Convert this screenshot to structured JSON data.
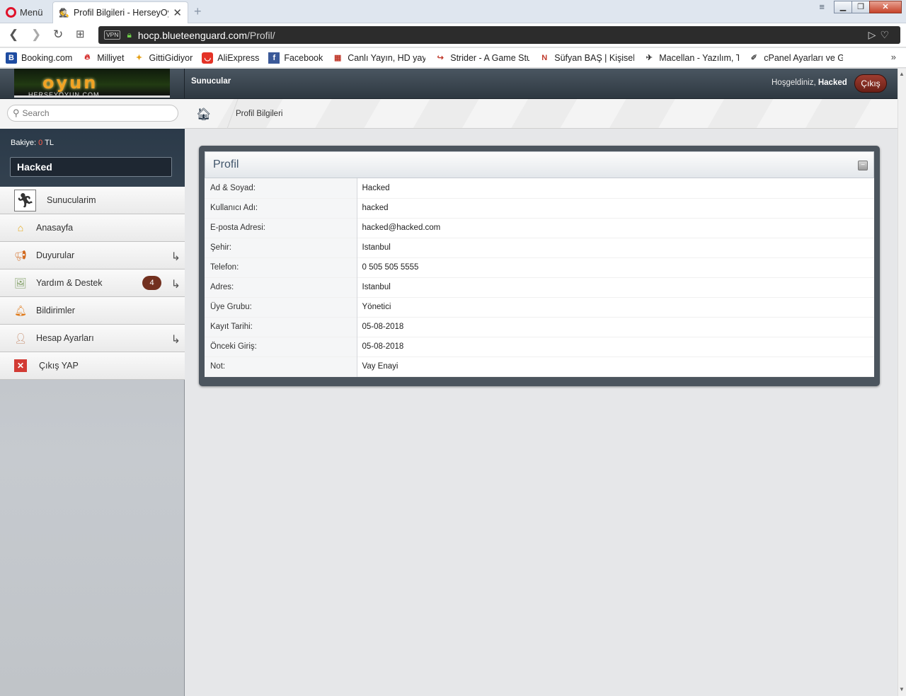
{
  "browser": {
    "menu_label": "Menü",
    "tab_title": "Profil Bilgileri - HerseyOyun",
    "url_host": "hocp.blueteenguard.com",
    "url_path": "/Profil/",
    "vpn_label": "VPN",
    "bookmarks": [
      {
        "label": "Booking.com",
        "icon": "B",
        "color": "#1e4ca1"
      },
      {
        "label": "Milliyet",
        "icon": "✔",
        "color": "#d2201f"
      },
      {
        "label": "GittiGidiyor",
        "icon": "✦",
        "color": "#e5a016"
      },
      {
        "label": "AliExpress",
        "icon": "◡",
        "color": "#e43226"
      },
      {
        "label": "Facebook",
        "icon": "f",
        "color": "#3b5998"
      },
      {
        "label": "Canlı Yayın, HD yayın",
        "icon": "▦",
        "color": "#c0392b"
      },
      {
        "label": "Strider - A Game Stud",
        "icon": "↪",
        "color": "#c0392b"
      },
      {
        "label": "Süfyan BAŞ | Kişisel w",
        "icon": "N",
        "color": "#c0392b"
      },
      {
        "label": "Macellan - Yazılım, Te",
        "icon": "✈",
        "color": "#333"
      },
      {
        "label": "cPanel Ayarları ve Gü",
        "icon": "✐",
        "color": "#555"
      }
    ],
    "more_bookmarks": "»"
  },
  "header": {
    "nav_link": "Sunucular",
    "welcome_prefix": "Hoşgeldiniz,",
    "welcome_user": "Hacked",
    "logout_label": "Çıkış",
    "logo_text": "oyun",
    "logo_subtext": "HERSEYOYUN.COM"
  },
  "sidebar": {
    "search_placeholder": "Search",
    "balance_label": "Bakiye:",
    "balance_amount": "0",
    "balance_currency": "TL",
    "username": "Hacked",
    "items": [
      {
        "label": "Sunucularim",
        "icon": "cs-icon"
      },
      {
        "label": "Anasayfa",
        "icon": "home-icon"
      },
      {
        "label": "Duyurular",
        "icon": "megaphone-icon",
        "has_arrow": true
      },
      {
        "label": "Yardım & Destek",
        "icon": "broken-image-icon",
        "has_arrow": true,
        "badge": "4"
      },
      {
        "label": "Bildirimler",
        "icon": "bell-icon"
      },
      {
        "label": "Hesap Ayarları",
        "icon": "user-settings-icon",
        "has_arrow": true
      },
      {
        "label": "Çıkış YAP",
        "icon": "close-icon"
      }
    ]
  },
  "breadcrumb": {
    "current": "Profil Bilgileri"
  },
  "profile": {
    "title": "Profil",
    "rows": [
      {
        "label": "Ad & Soyad:",
        "value": "Hacked"
      },
      {
        "label": "Kullanıcı Adı:",
        "value": "hacked"
      },
      {
        "label": "E-posta Adresi:",
        "value": "hacked@hacked.com"
      },
      {
        "label": "Şehir:",
        "value": "Istanbul"
      },
      {
        "label": "Telefon:",
        "value": "0 505 505 5555"
      },
      {
        "label": "Adres:",
        "value": "Istanbul"
      },
      {
        "label": "Üye Grubu:",
        "value": "Yönetici"
      },
      {
        "label": "Kayıt Tarihi:",
        "value": "05-08-2018"
      },
      {
        "label": "Önceki Giriş:",
        "value": "05-08-2018"
      },
      {
        "label": "Not:",
        "value": "Vay Enayi"
      }
    ]
  }
}
